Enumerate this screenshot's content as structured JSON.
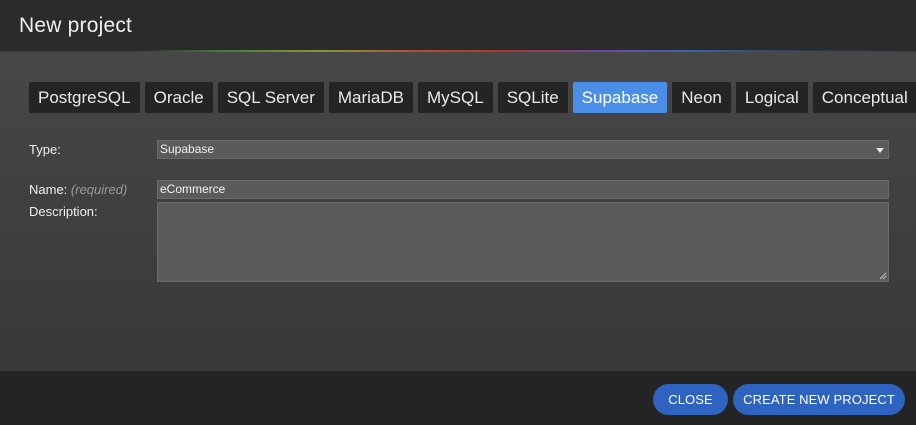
{
  "dialog": {
    "title": "New project"
  },
  "tabs": [
    {
      "label": "PostgreSQL",
      "active": false
    },
    {
      "label": "Oracle",
      "active": false
    },
    {
      "label": "SQL Server",
      "active": false
    },
    {
      "label": "MariaDB",
      "active": false
    },
    {
      "label": "MySQL",
      "active": false
    },
    {
      "label": "SQLite",
      "active": false
    },
    {
      "label": "Supabase",
      "active": true
    },
    {
      "label": "Neon",
      "active": false
    },
    {
      "label": "Logical",
      "active": false
    },
    {
      "label": "Conceptual",
      "active": false
    }
  ],
  "form": {
    "type_label": "Type:",
    "type_value": "Supabase",
    "name_label": "Name:",
    "name_hint": "(required)",
    "name_value": "eCommerce",
    "description_label": "Description:",
    "description_value": ""
  },
  "footer": {
    "close_label": "CLOSE",
    "create_label": "CREATE NEW PROJECT"
  },
  "colors": {
    "active_tab": "#4a8fe7",
    "button": "#2f63c0"
  },
  "icons": {
    "select_caret": "chevron-down-icon",
    "resize_grip": "resize-grip-icon"
  }
}
